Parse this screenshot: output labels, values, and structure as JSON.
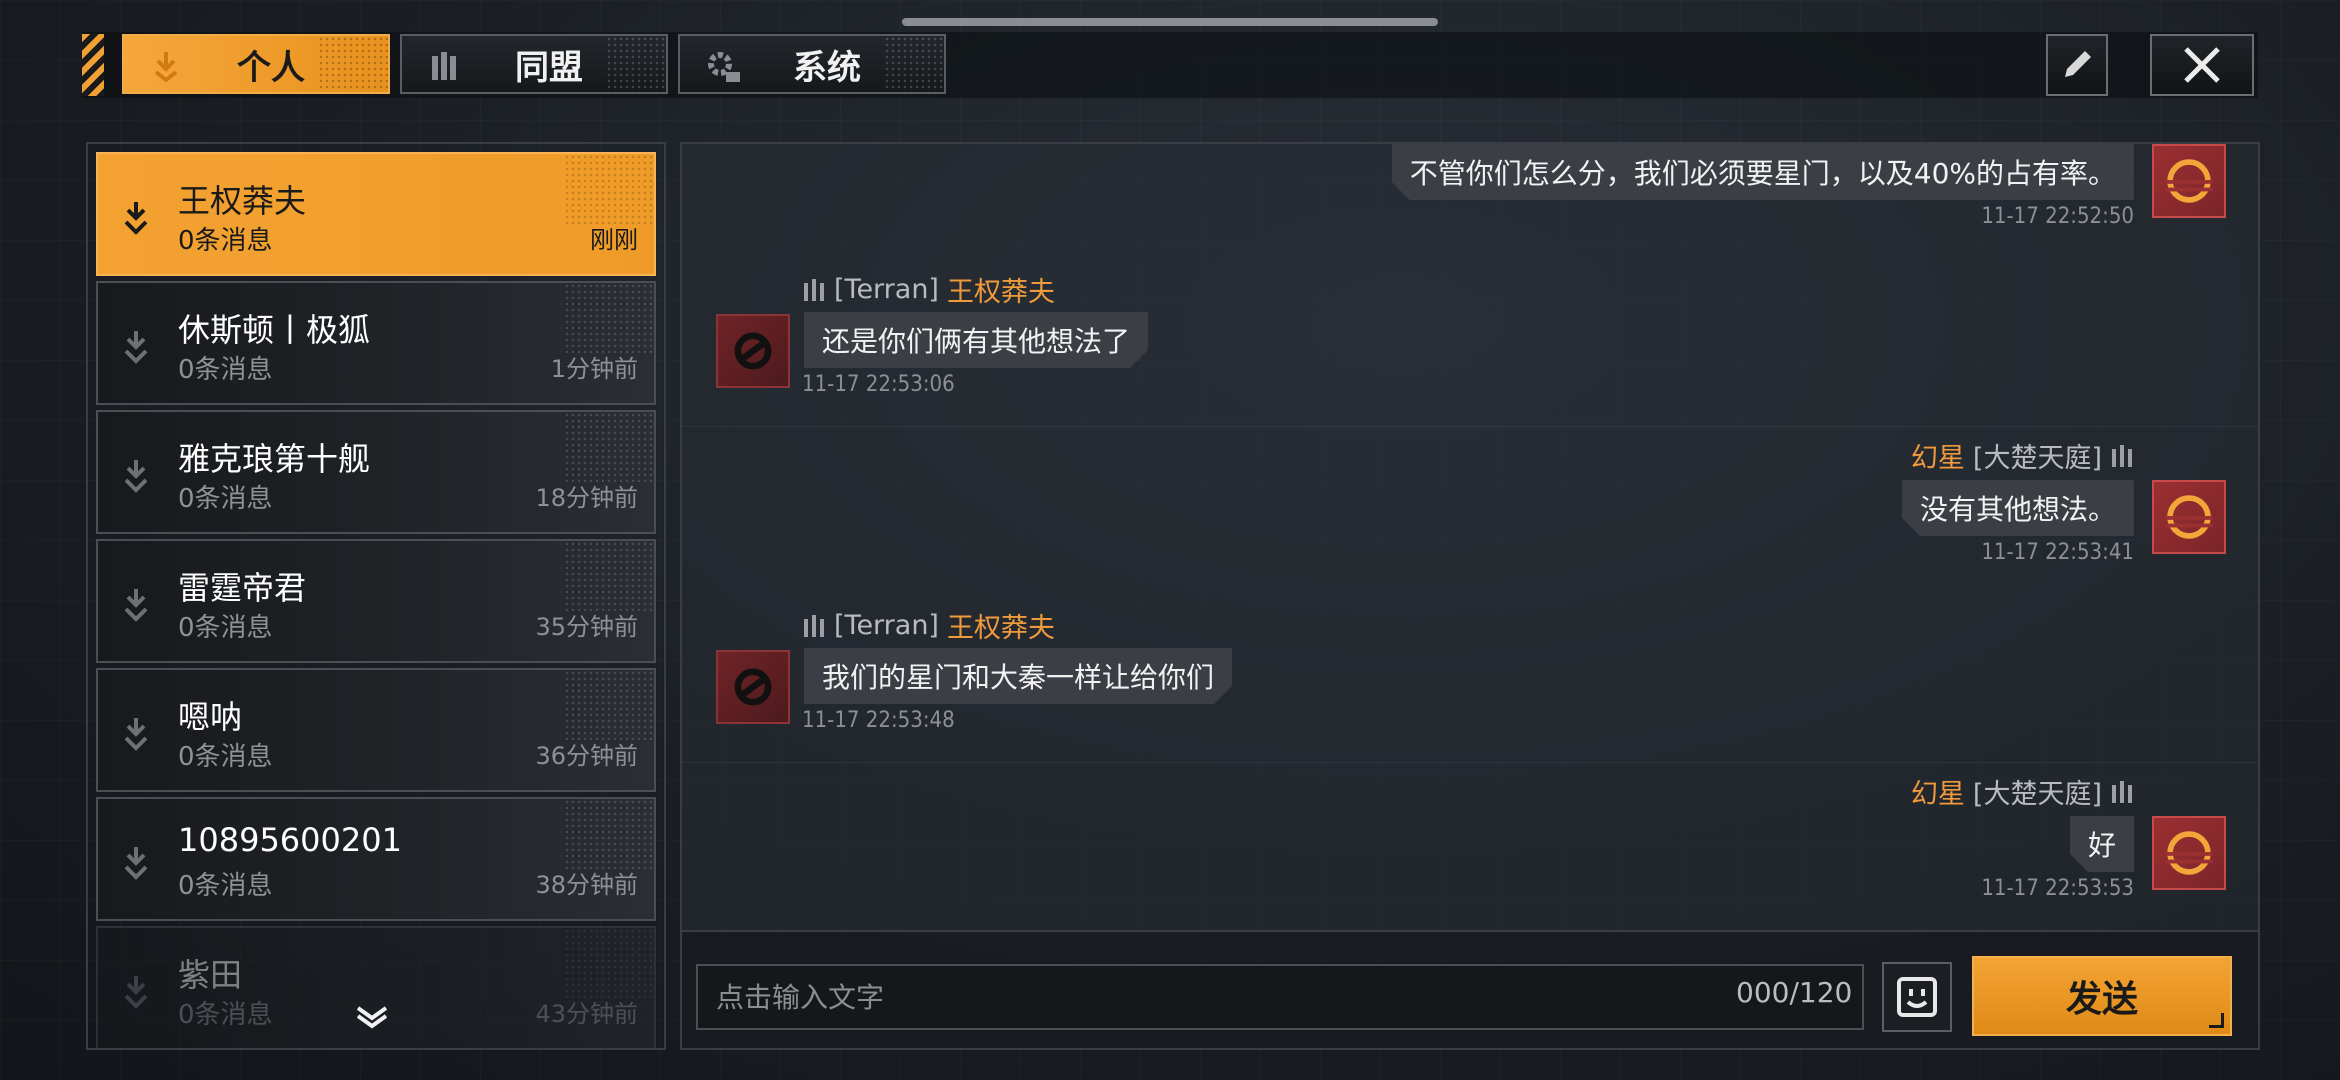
{
  "tabs": [
    {
      "label": "个人",
      "icon": "download-arrow-icon",
      "active": true
    },
    {
      "label": "同盟",
      "icon": "alliance-icon",
      "active": false
    },
    {
      "label": "系统",
      "icon": "gear-icon",
      "active": false
    }
  ],
  "toolbar": {
    "edit_icon": "pencil-icon",
    "close_icon": "close-icon"
  },
  "contacts": [
    {
      "name": "王权莽夫",
      "messages": "0条消息",
      "time": "刚刚",
      "active": true
    },
    {
      "name": "休斯顿丨极狐",
      "messages": "0条消息",
      "time": "1分钟前"
    },
    {
      "name": "雅克琅第十舰",
      "messages": "0条消息",
      "time": "18分钟前"
    },
    {
      "name": "雷霆帝君",
      "messages": "0条消息",
      "time": "35分钟前"
    },
    {
      "name": "嗯呐",
      "messages": "0条消息",
      "time": "36分钟前"
    },
    {
      "name": "10895600201",
      "messages": "0条消息",
      "time": "38分钟前"
    },
    {
      "name": "紫田",
      "messages": "0条消息",
      "time": "43分钟前"
    }
  ],
  "chat": {
    "messages": [
      {
        "side": "right",
        "text": "不管你们怎么分，我们必须要星门，以及40%的占有率。",
        "time": "11-17 22:52:50"
      },
      {
        "side": "left",
        "guild": "[Terran]",
        "nick": "王权莽夫",
        "text": "还是你们俩有其他想法了",
        "time": "11-17 22:53:06"
      },
      {
        "side": "right",
        "nick": "幻星",
        "guild": "[大楚天庭]",
        "text": "没有其他想法。",
        "time": "11-17 22:53:41"
      },
      {
        "side": "left",
        "guild": "[Terran]",
        "nick": "王权莽夫",
        "text": "我们的星门和大秦一样让给你们",
        "time": "11-17 22:53:48"
      },
      {
        "side": "right",
        "nick": "幻星",
        "guild": "[大楚天庭]",
        "text": "好",
        "time": "11-17 22:53:53"
      }
    ]
  },
  "input": {
    "placeholder": "点击输入文字",
    "value": "",
    "counter": "000/120",
    "send_label": "发送",
    "emoji_icon": "emoji-face-icon"
  },
  "colors": {
    "accent": "#f0a034",
    "nick": "#ef9a3c",
    "avatar_red": "#9b2f32"
  }
}
